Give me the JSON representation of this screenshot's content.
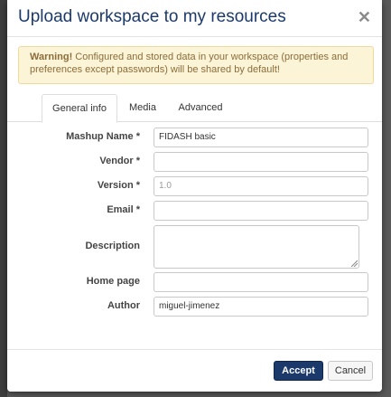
{
  "dialog": {
    "title": "Upload workspace to my resources",
    "close_icon": "close-icon"
  },
  "warning": {
    "strong": "Warning!",
    "text": " Configured and stored data in your workspace (properties and preferences except passwords) will be shared by default!"
  },
  "tabs": [
    {
      "label": "General info",
      "active": true
    },
    {
      "label": "Media",
      "active": false
    },
    {
      "label": "Advanced",
      "active": false
    }
  ],
  "form": {
    "mashup_name": {
      "label": "Mashup Name *",
      "value": "FIDASH basic"
    },
    "vendor": {
      "label": "Vendor *",
      "value": ""
    },
    "version": {
      "label": "Version *",
      "placeholder": "1.0"
    },
    "email": {
      "label": "Email *",
      "value": ""
    },
    "description": {
      "label": "Description",
      "value": ""
    },
    "home_page": {
      "label": "Home page",
      "value": ""
    },
    "author": {
      "label": "Author",
      "value": "miguel-jimenez"
    }
  },
  "footer": {
    "accept_label": "Accept",
    "cancel_label": "Cancel"
  },
  "colors": {
    "title": "#1b3a6b",
    "primary_button": "#1b3a6b",
    "warning_bg": "#fcf4d6",
    "warning_text": "#8a6d3b"
  }
}
